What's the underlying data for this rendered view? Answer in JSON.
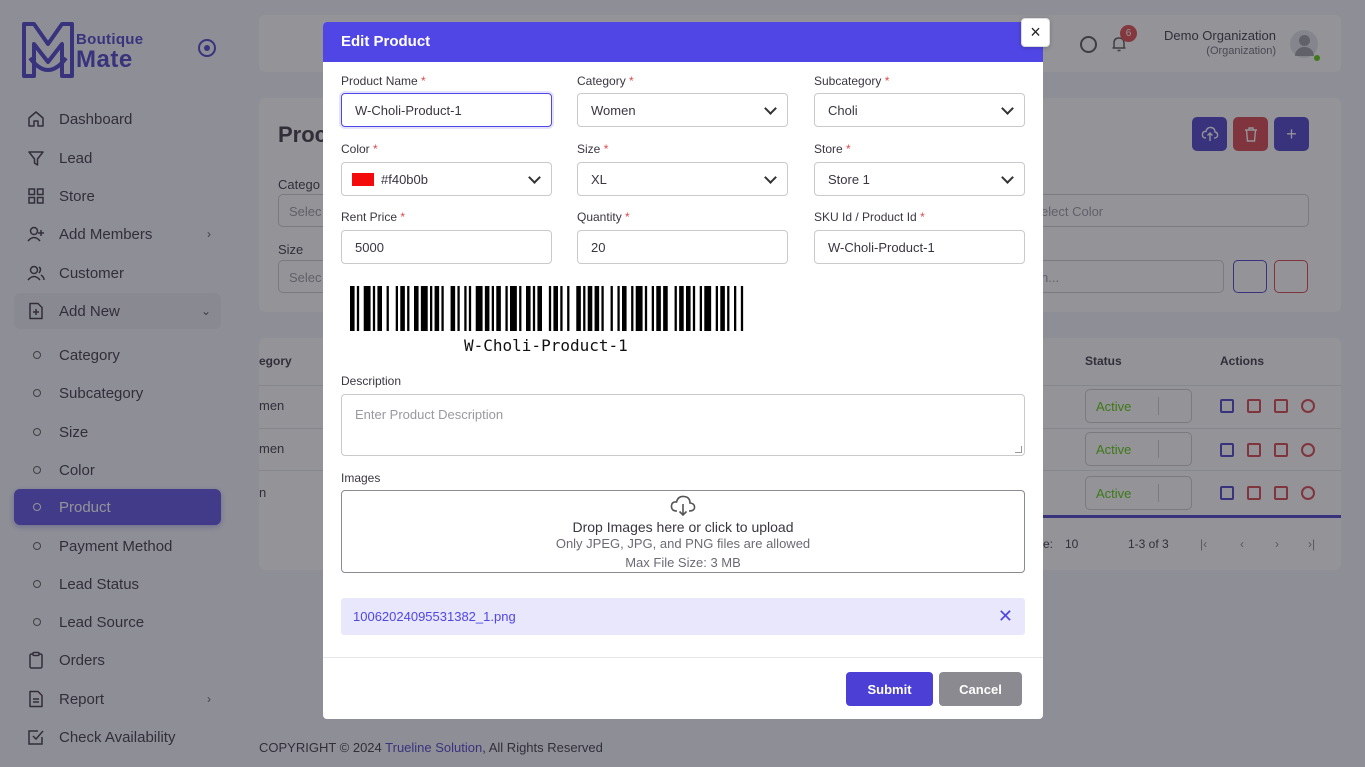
{
  "sidebar": {
    "logo_line1": "Boutique",
    "logo_line2": "Mate",
    "items": [
      {
        "label": "Dashboard"
      },
      {
        "label": "Lead"
      },
      {
        "label": "Store"
      },
      {
        "label": "Add Members"
      },
      {
        "label": "Customer"
      },
      {
        "label": "Add New"
      },
      {
        "label": "Category"
      },
      {
        "label": "Subcategory"
      },
      {
        "label": "Size"
      },
      {
        "label": "Color"
      },
      {
        "label": "Product"
      },
      {
        "label": "Payment Method"
      },
      {
        "label": "Lead Status"
      },
      {
        "label": "Lead Source"
      },
      {
        "label": "Orders"
      },
      {
        "label": "Report"
      },
      {
        "label": "Check Availability"
      }
    ]
  },
  "topbar": {
    "notification_count": "6",
    "org_name": "Demo Organization",
    "org_role": "(Organization)"
  },
  "page": {
    "heading": "Proc",
    "filter_category_label": "Catego",
    "filter_category_placeholder": "Selec",
    "filter_size_label": "Size",
    "filter_size_placeholder": "Selec",
    "filter_color_placeholder": "elect Color",
    "filter_search_placeholder": "n..."
  },
  "table": {
    "headers": {
      "category": "egory",
      "status": "Status",
      "actions": "Actions"
    },
    "rows": [
      {
        "category": "men",
        "status": "Active"
      },
      {
        "category": "men",
        "status": "Active"
      },
      {
        "category": "n",
        "status": "Active"
      }
    ],
    "pager_rows_label": "e:",
    "pager_rows_value": "10",
    "pager_range": "1-3 of 3"
  },
  "footer": {
    "prefix": "COPYRIGHT © 2024 ",
    "link": "Trueline Solution",
    "suffix": ", All Rights Reserved"
  },
  "modal": {
    "title": "Edit Product",
    "close_glyph": "×",
    "required_mark": "*",
    "fields": {
      "product_name": {
        "label": "Product Name",
        "value": "W-Choli-Product-1"
      },
      "category": {
        "label": "Category",
        "value": "Women"
      },
      "subcategory": {
        "label": "Subcategory",
        "value": "Choli"
      },
      "color": {
        "label": "Color",
        "value": "#f40b0b",
        "swatch": "#f40b0b"
      },
      "size": {
        "label": "Size",
        "value": "XL"
      },
      "store": {
        "label": "Store",
        "value": "Store 1"
      },
      "rent_price": {
        "label": "Rent Price",
        "value": "5000"
      },
      "quantity": {
        "label": "Quantity",
        "value": "20"
      },
      "sku": {
        "label": "SKU Id / Product Id",
        "value": "W-Choli-Product-1"
      }
    },
    "barcode_text": "W-Choli-Product-1",
    "description_label": "Description",
    "description_placeholder": "Enter Product Description",
    "images_label": "Images",
    "drop_title": "Drop Images here or click to upload",
    "drop_formats": "Only JPEG, JPG, and PNG files are allowed",
    "drop_max": "Max File Size: 3 MB",
    "file_name": "10062024095531382_1.png",
    "submit_label": "Submit",
    "cancel_label": "Cancel"
  },
  "colors": {
    "primary": "#5046e5",
    "sidebar_active": "#5b4fe0",
    "danger": "#e04848",
    "success": "#56ca00"
  }
}
